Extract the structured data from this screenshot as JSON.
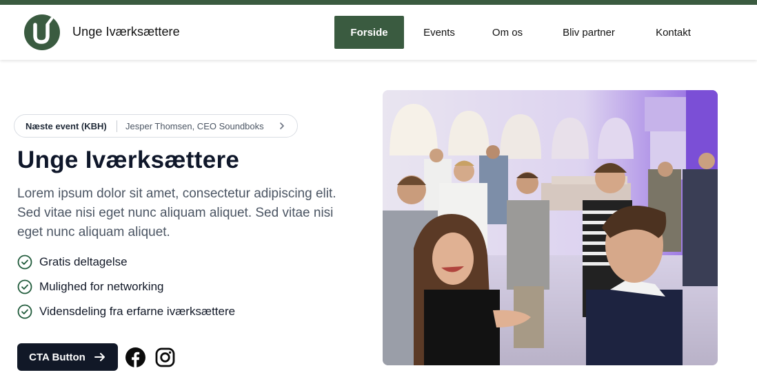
{
  "brand": {
    "name": "Unge Iværksættere"
  },
  "nav": {
    "items": [
      {
        "label": "Forside",
        "active": true
      },
      {
        "label": "Events",
        "active": false
      },
      {
        "label": "Om os",
        "active": false
      },
      {
        "label": "Bliv partner",
        "active": false
      },
      {
        "label": "Kontakt",
        "active": false
      }
    ]
  },
  "announcement": {
    "tag": "Næste event (KBH)",
    "text": "Jesper Thomsen, CEO Soundboks",
    "icon": "chevron-right-icon"
  },
  "hero": {
    "title": "Unge Iværksættere",
    "lead": "Lorem ipsum dolor sit amet, consectetur adipiscing elit. Sed vitae nisi eget nunc aliquam aliquet. Sed vitae nisi eget nunc aliquam aliquet.",
    "features": [
      "Gratis deltagelse",
      "Mulighed for networking",
      "Vidensdeling fra erfarne iværksættere"
    ],
    "cta_label": "CTA Button",
    "cta_icon": "arrow-right-icon"
  },
  "social": [
    {
      "icon": "facebook-icon"
    },
    {
      "icon": "instagram-icon"
    }
  ],
  "colors": {
    "brand_green": "#3a5b40",
    "dark": "#111827",
    "check_green": "#1f5a3a"
  }
}
